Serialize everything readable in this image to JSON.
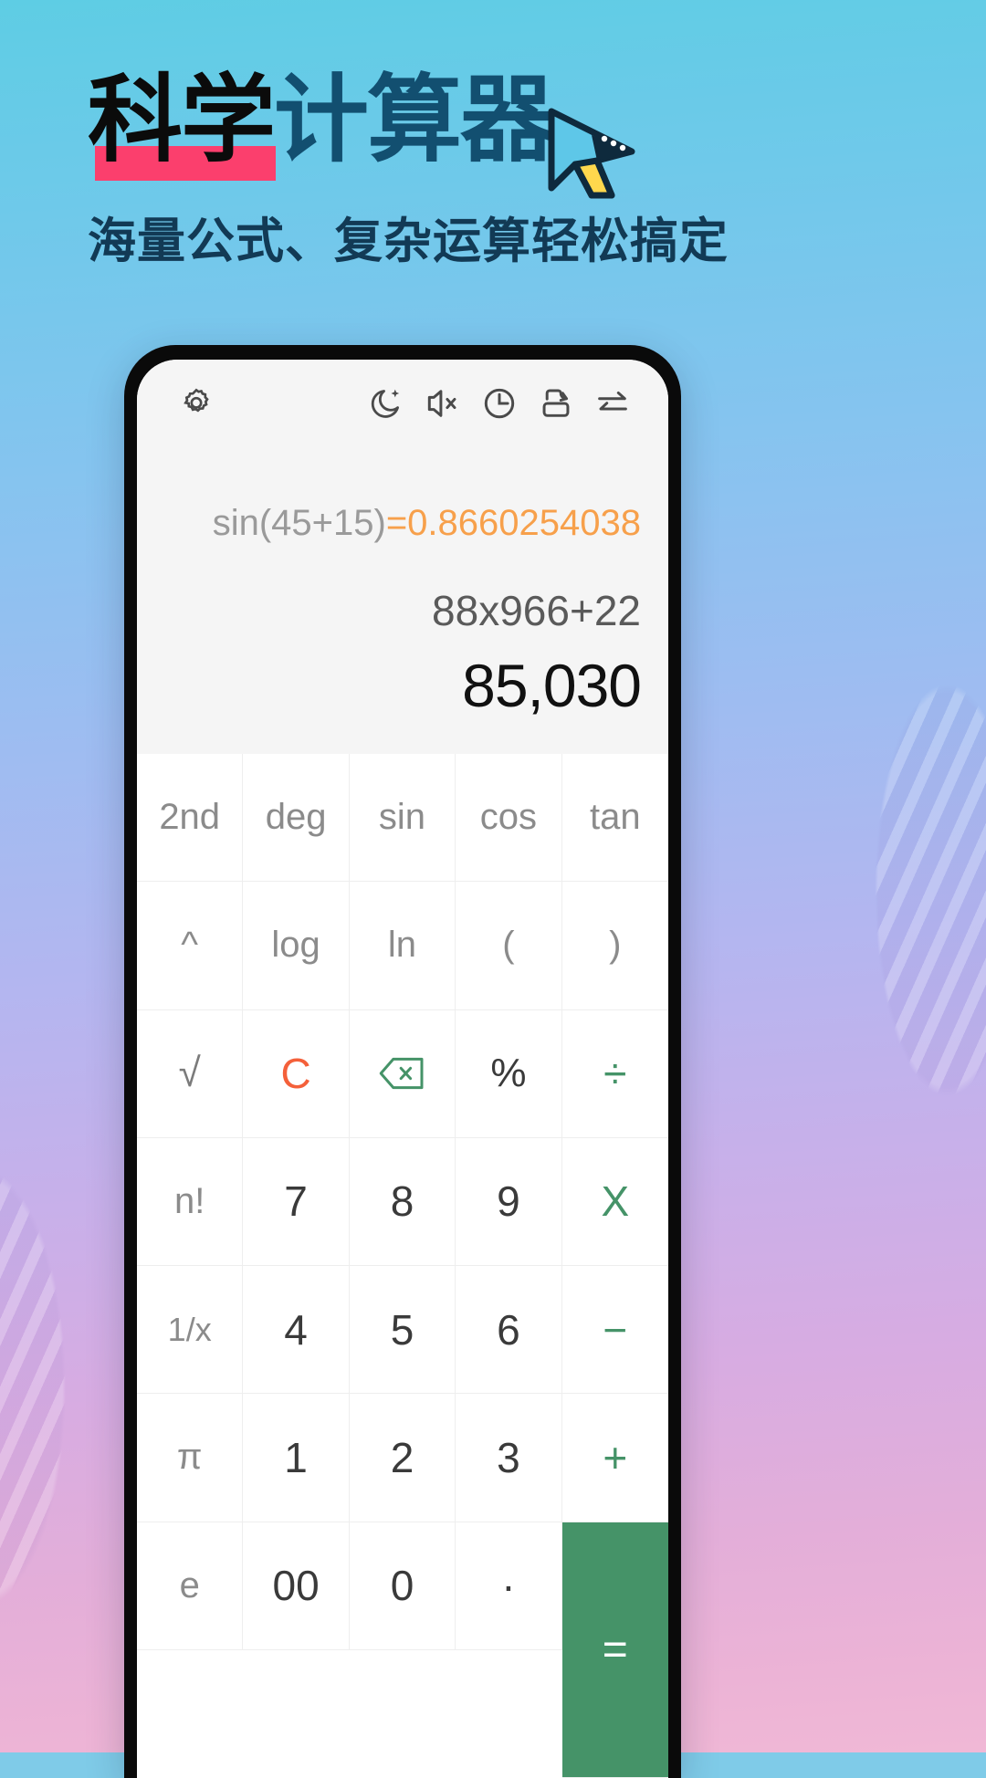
{
  "poster": {
    "headline_part1": "科学",
    "headline_part2": "计算器",
    "subtitle": "海量公式、复杂运算轻松搞定",
    "colors": {
      "headline_dark": "#0b0b0b",
      "headline_blue": "#124f70",
      "underline_pink": "#fb3f6d",
      "bg_top": "#5ecde4",
      "bg_bottom": "#f0b8d6"
    }
  },
  "toolbar": {
    "icons": [
      {
        "name": "settings-gear-icon"
      },
      {
        "name": "night-mode-moon-icon"
      },
      {
        "name": "sound-mute-icon"
      },
      {
        "name": "history-clock-icon"
      },
      {
        "name": "screen-rotate-icon"
      },
      {
        "name": "unit-convert-swap-icon"
      }
    ]
  },
  "display": {
    "history_expression": "sin(45+15)",
    "history_result": "=0.8660254038",
    "expression": "88x966+22",
    "result": "85,030",
    "result_color": "#f7a04b"
  },
  "keypad": {
    "rows": [
      [
        {
          "label": "2nd",
          "name": "key-2nd",
          "kind": "fn"
        },
        {
          "label": "deg",
          "name": "key-deg",
          "kind": "fn"
        },
        {
          "label": "sin",
          "name": "key-sin",
          "kind": "fn"
        },
        {
          "label": "cos",
          "name": "key-cos",
          "kind": "fn"
        },
        {
          "label": "tan",
          "name": "key-tan",
          "kind": "fn"
        }
      ],
      [
        {
          "label": "^",
          "name": "key-power",
          "kind": "fn"
        },
        {
          "label": "log",
          "name": "key-log",
          "kind": "fn"
        },
        {
          "label": "ln",
          "name": "key-ln",
          "kind": "fn"
        },
        {
          "label": "(",
          "name": "key-paren-open",
          "kind": "fn"
        },
        {
          "label": ")",
          "name": "key-paren-close",
          "kind": "fn"
        }
      ],
      [
        {
          "label": "√",
          "name": "key-sqrt",
          "kind": "root"
        },
        {
          "label": "C",
          "name": "key-clear",
          "kind": "clear"
        },
        {
          "label": "",
          "name": "key-backspace",
          "kind": "backspace"
        },
        {
          "label": "%",
          "name": "key-percent",
          "kind": "pct"
        },
        {
          "label": "÷",
          "name": "key-divide",
          "kind": "op"
        }
      ],
      [
        {
          "label": "n!",
          "name": "key-factorial",
          "kind": "fn"
        },
        {
          "label": "7",
          "name": "key-7",
          "kind": "num"
        },
        {
          "label": "8",
          "name": "key-8",
          "kind": "num"
        },
        {
          "label": "9",
          "name": "key-9",
          "kind": "num"
        },
        {
          "label": "X",
          "name": "key-multiply",
          "kind": "op"
        }
      ],
      [
        {
          "label": "1/x",
          "name": "key-reciprocal",
          "kind": "fn-small"
        },
        {
          "label": "4",
          "name": "key-4",
          "kind": "num"
        },
        {
          "label": "5",
          "name": "key-5",
          "kind": "num"
        },
        {
          "label": "6",
          "name": "key-6",
          "kind": "num"
        },
        {
          "label": "−",
          "name": "key-minus",
          "kind": "op"
        }
      ],
      [
        {
          "label": "π",
          "name": "key-pi",
          "kind": "fn"
        },
        {
          "label": "1",
          "name": "key-1",
          "kind": "num"
        },
        {
          "label": "2",
          "name": "key-2",
          "kind": "num"
        },
        {
          "label": "3",
          "name": "key-3",
          "kind": "num"
        },
        {
          "label": "+",
          "name": "key-plus",
          "kind": "op"
        }
      ],
      [
        {
          "label": "e",
          "name": "key-e",
          "kind": "fn"
        },
        {
          "label": "00",
          "name": "key-double-zero",
          "kind": "num"
        },
        {
          "label": "0",
          "name": "key-0",
          "kind": "num"
        },
        {
          "label": "·",
          "name": "key-decimal",
          "kind": "num"
        },
        {
          "label": "=",
          "name": "key-equals",
          "kind": "equals"
        }
      ]
    ],
    "colors": {
      "operator_green": "#459368",
      "clear_orange": "#f4603a",
      "function_gray": "#8b8b8b",
      "number_dark": "#3a3a3a"
    }
  }
}
